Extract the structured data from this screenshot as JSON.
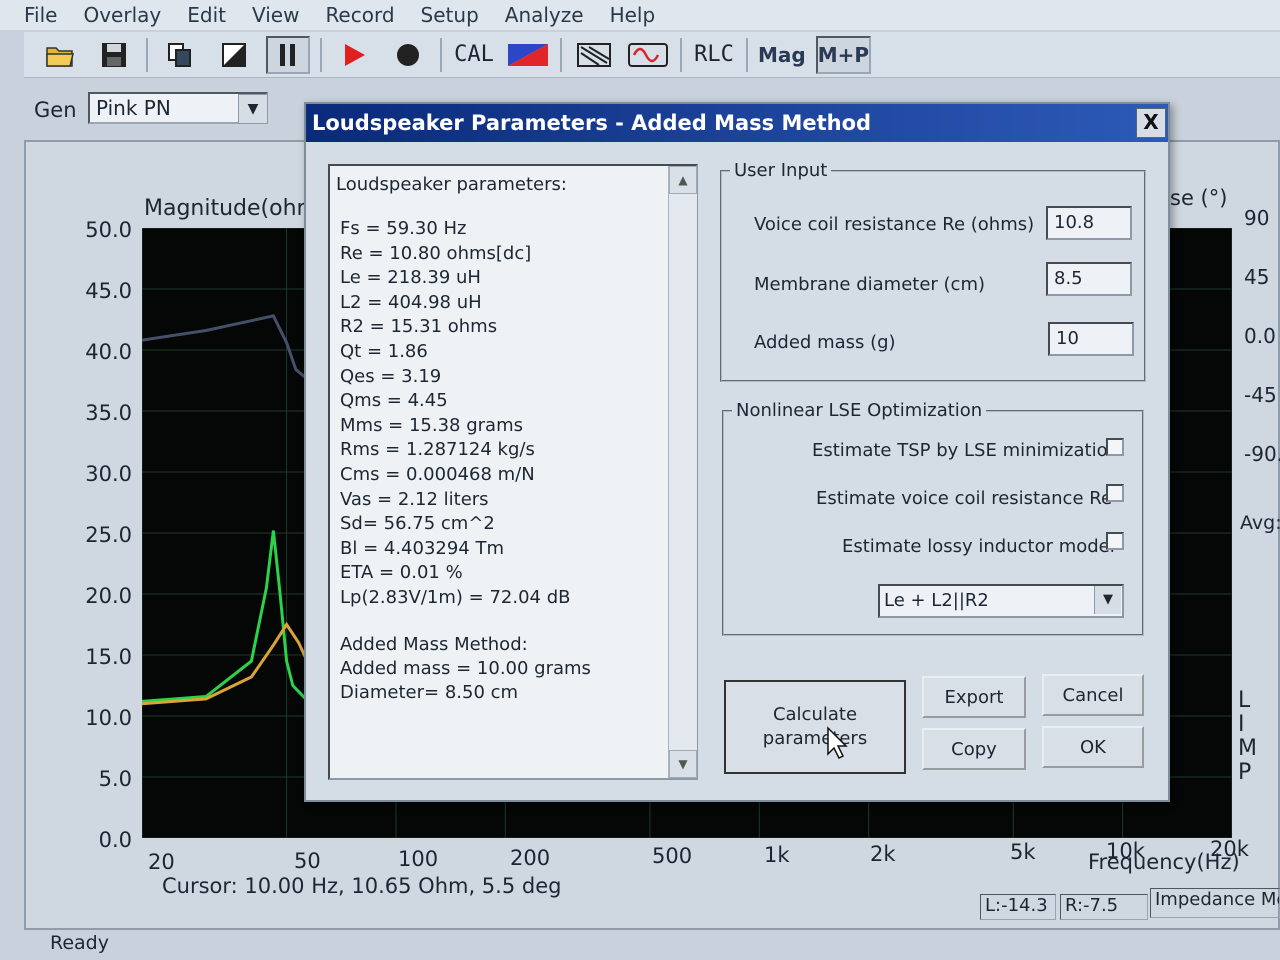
{
  "menu": [
    "File",
    "Overlay",
    "Edit",
    "View",
    "Record",
    "Setup",
    "Analyze",
    "Help"
  ],
  "toolbar": {
    "cal_label": "CAL",
    "rlc_label": "RLC",
    "mag_label": "Mag",
    "mp_label": "M+P"
  },
  "generator": {
    "label": "Gen",
    "value": "Pink PN"
  },
  "chart": {
    "y_title": "Magnitude(ohr",
    "y_ticks": [
      "50.0",
      "45.0",
      "40.0",
      "35.0",
      "30.0",
      "25.0",
      "20.0",
      "15.0",
      "10.0",
      "5.0",
      "0.0"
    ],
    "phase_title": "se (°)",
    "phase_ticks": [
      "90",
      "45",
      "0.0",
      "-45",
      "-90."
    ],
    "x_ticks": [
      "20",
      "50",
      "100",
      "200",
      "500",
      "1k",
      "2k",
      "5k",
      "10k",
      "20k"
    ],
    "x_title": "Frequency(Hz)",
    "avg_label": "Avg:",
    "side_letters": [
      "L",
      "I",
      "M",
      "P"
    ],
    "cursor": "Cursor: 10.00 Hz, 10.65 Ohm, 5.5 deg"
  },
  "chart_data": {
    "type": "line",
    "title": "",
    "xlabel": "Frequency(Hz)",
    "ylabel": "Magnitude(ohr",
    "x_scale": "log",
    "xlim": [
      20,
      20000
    ],
    "ylim": [
      0,
      50
    ],
    "grid": true,
    "series": [
      {
        "color": "#2bd24a",
        "x": [
          20,
          30,
          40,
          44,
          46,
          48,
          50,
          52,
          56,
          60
        ],
        "values": [
          11.2,
          11.6,
          14.5,
          20.5,
          25.2,
          20.0,
          14.5,
          12.5,
          11.5,
          11.2
        ]
      },
      {
        "color": "#d9a33a",
        "x": [
          20,
          30,
          40,
          46,
          50,
          54,
          58,
          60
        ],
        "values": [
          11.0,
          11.4,
          13.2,
          15.8,
          17.5,
          16.0,
          14.0,
          13.0
        ]
      },
      {
        "color": "#44506a",
        "x": [
          20,
          30,
          40,
          46,
          50,
          53,
          56
        ],
        "values": [
          40.8,
          41.6,
          42.4,
          42.8,
          40.6,
          38.4,
          37.8
        ]
      }
    ]
  },
  "status": {
    "left": "L:-14.3",
    "right": "R:-7.5",
    "mode": "Impedance Mea",
    "ready": "Ready"
  },
  "dialog": {
    "title": "Loudspeaker Parameters - Added Mass Method",
    "close": "X",
    "results_heading": "Loudspeaker parameters:",
    "results": [
      "Fs  = 59.30 Hz",
      "Re  = 10.80 ohms[dc]",
      "Le  = 218.39 uH",
      "L2  = 404.98 uH",
      "R2  = 15.31 ohms",
      "Qt  = 1.86",
      "Qes = 3.19",
      "Qms = 4.45",
      "Mms = 15.38 grams",
      "Rms = 1.287124 kg/s",
      "Cms = 0.000468 m/N",
      "Vas = 2.12 liters",
      "Sd= 56.75 cm^2",
      "Bl  = 4.403294 Tm",
      "ETA = 0.01 %",
      "Lp(2.83V/1m) = 72.04 dB"
    ],
    "added_mass_heading": "Added Mass Method:",
    "added_mass_lines": [
      "Added mass = 10.00 grams",
      "Diameter= 8.50 cm"
    ],
    "user_input": {
      "title": "User Input",
      "re_label": "Voice coil resistance Re (ohms)",
      "re_value": "10.8",
      "diam_label": "Membrane diameter (cm)",
      "diam_value": "8.5",
      "mass_label": "Added mass (g)",
      "mass_value": "10"
    },
    "lse": {
      "title": "Nonlinear LSE Optimization",
      "opt1": "Estimate TSP by LSE minimization",
      "opt2": "Estimate voice coil resistance Re",
      "opt3": "Estimate lossy inductor model",
      "model": "Le + L2||R2"
    },
    "buttons": {
      "calc_line1": "Calculate",
      "calc_line2": "parameters",
      "export": "Export",
      "cancel": "Cancel",
      "copy": "Copy",
      "ok": "OK"
    }
  }
}
